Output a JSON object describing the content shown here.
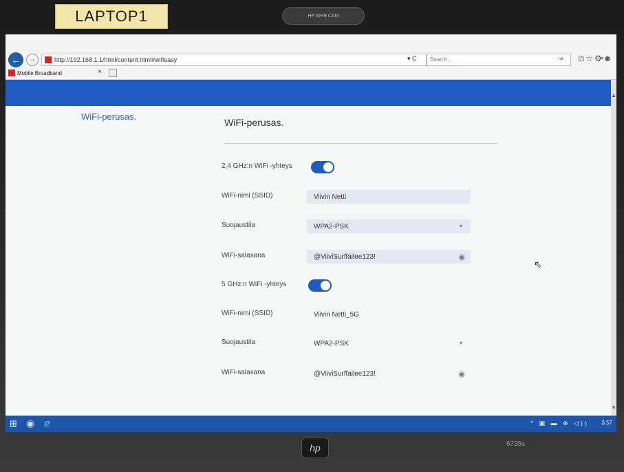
{
  "sticker": {
    "text": "LAPTOP1"
  },
  "bezel": {
    "webcam_label": "HP WEB CAM",
    "hp_logo": "hp",
    "model": "6735s"
  },
  "browser": {
    "url": "http://192.168.1.1/html/content.html#wifieasy",
    "search_placeholder": "Search...",
    "tab_label": "Mobile Broadband",
    "tab_close": "×",
    "back": "←",
    "forward": "→",
    "addr_tools": "▾ C",
    "search_icon": "⌕",
    "tool_icons": "⌂☆⚙☻",
    "window_controls": "– ▢ ×"
  },
  "sidebar": {
    "item": "WiFi-perusas."
  },
  "main": {
    "title": "WiFi-perusas.",
    "band24": {
      "toggle_label": "2,4 GHz:n WiFi -yhteys",
      "toggle_on": true,
      "ssid_label": "WiFi-nimi (SSID)",
      "ssid_value": "Viivin Netti",
      "security_label": "Suojaustila",
      "security_value": "WPA2-PSK",
      "password_label": "WiFi-salasana",
      "password_value": "@ViiviSurffailee123!"
    },
    "band5": {
      "toggle_label": "5 GHz:n WiFi -yhteys",
      "toggle_on": true,
      "ssid_label": "WiFi-nimi (SSID)",
      "ssid_value": "Viivin Netti_5G",
      "security_label": "Suojaustila",
      "security_value": "WPA2-PSK",
      "password_label": "WiFi-salasana",
      "password_value": "@ViiviSurffailee123!"
    }
  },
  "taskbar": {
    "clock": "3.57",
    "tray_icons": "^ ▣ ▬ ⊕ ◁))"
  },
  "icons": {
    "eye": "eye-icon",
    "caret": "chevron-down-icon",
    "cursor": "mouse-pointer-icon"
  },
  "colors": {
    "accent": "#1e5cc0",
    "link": "#2d63c4",
    "sticker": "#f2e6a8"
  }
}
